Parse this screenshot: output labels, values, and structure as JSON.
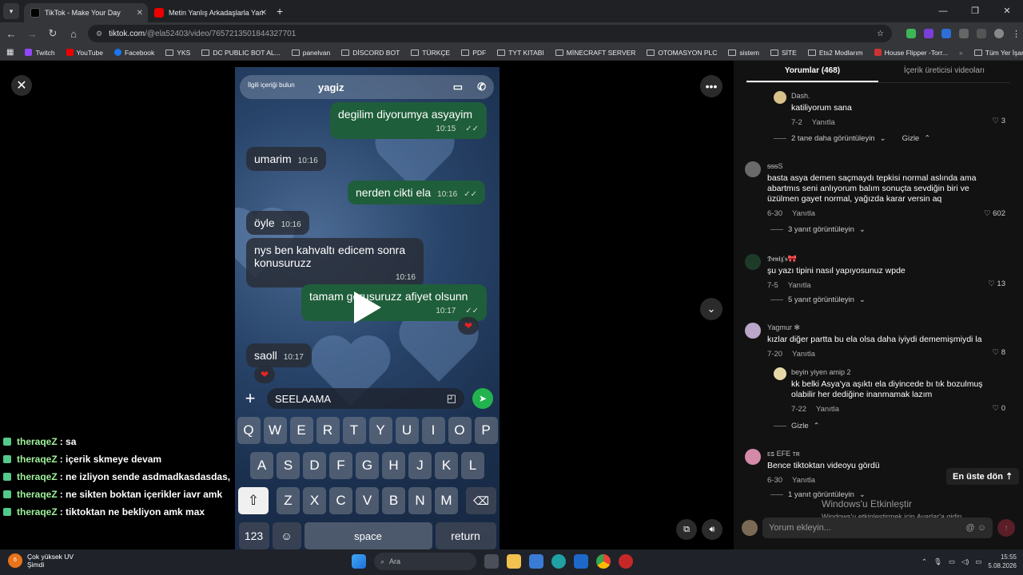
{
  "browser": {
    "tabs": [
      {
        "title": "TikTok - Make Your Day",
        "active": true
      },
      {
        "title": "Metin Yanlış Arkadaşlarla Yanlış",
        "active": false
      }
    ],
    "url_host": "tiktok.com",
    "url_path": "/@ela52403/video/7657213501844327701",
    "bookmarks": [
      "Twitch",
      "YouTube",
      "Facebook",
      "YKS",
      "DC PUBLIC BOT AL...",
      "panelvan",
      "DİSCORD BOT",
      "TÜRKÇE",
      "PDF",
      "TYT KITABI",
      "MİNECRAFT SERVER",
      "OTOMASYON PLC",
      "sistem",
      "SİTE",
      "Ets2 Modlarım",
      "House Flipper -Torr..."
    ],
    "all_bookmarks": "Tüm Yer İşaretleri"
  },
  "video": {
    "header_hint": "İlgili içeriği bulun",
    "contact_name": "yagiz",
    "messages": [
      {
        "dir": "out",
        "text": "degilim diyorumya asyayim",
        "time": "10:15"
      },
      {
        "dir": "in",
        "text": "umarim",
        "time": "10:16"
      },
      {
        "dir": "out",
        "text": "nerden cikti ela",
        "time": "10:16"
      },
      {
        "dir": "in",
        "text": "öyle",
        "time": "10:16"
      },
      {
        "dir": "in",
        "text": "nys ben kahvaltı edicem sonra konusuruzz",
        "time": "10:16"
      },
      {
        "dir": "out",
        "text": "tamam gorusuruzz afiyet olsunn",
        "time": "10:17"
      },
      {
        "dir": "in",
        "text": "saoll",
        "time": "10:17"
      }
    ],
    "composer_text": "SEELAAMA",
    "keyboard": {
      "row1": [
        "Q",
        "W",
        "E",
        "R",
        "T",
        "Y",
        "U",
        "I",
        "O",
        "P"
      ],
      "row2": [
        "A",
        "S",
        "D",
        "F",
        "G",
        "H",
        "J",
        "K",
        "L"
      ],
      "row3": [
        "Z",
        "X",
        "C",
        "V",
        "B",
        "N",
        "M"
      ],
      "num": "123",
      "space": "space",
      "return": "return"
    }
  },
  "live_chat": [
    {
      "user": "theraqeZ",
      "text": ": sa"
    },
    {
      "user": "theraqeZ",
      "text": ": içerik skmeye devam"
    },
    {
      "user": "theraqeZ",
      "text": ": ne izliyon sende asdmadkasdasdas,"
    },
    {
      "user": "theraqeZ",
      "text": ": ne sikten boktan içerikler iavr amk"
    },
    {
      "user": "theraqeZ",
      "text": ": tiktoktan ne bekliyon amk max"
    }
  ],
  "comments_panel": {
    "tab_comments": "Yorumlar (468)",
    "tab_creator": "İçerik üreticisi videoları",
    "comments": [
      {
        "user": "Dash.",
        "text": "katiliyorum sana",
        "date": "7-2",
        "reply": "Yanıtla",
        "likes": "3"
      },
      {
        "user": "ᵴᵴᵴS",
        "text": "basta asya demen saçmaydı tepkisi normal aslında ama abartmıs seni anlıyorum balım sonuçta sevdiğin biri ve üzülmen gayet normal, yağızda karar versin aq",
        "date": "6-30",
        "reply": "Yanıtla",
        "likes": "602"
      },
      {
        "user": "𝕯𝖊𝖓𝖎𝖟'𝖘🎀",
        "text": "şu yazı tipini nasıl yapıyosunuz wpde",
        "date": "7-5",
        "reply": "Yanıtla",
        "likes": "13"
      },
      {
        "user": "Yagmur ✻",
        "text": "kızlar diğer partta bu ela olsa daha iyiydi dememişmiydi la",
        "date": "7-20",
        "reply": "Yanıtla",
        "likes": "8"
      },
      {
        "user": "beyin yiyen amip 2",
        "text": "kk belki Asya'ya aşıktı ela diyincede bı tık bozulmuş olabilir her dediğine inanmamak lazım",
        "date": "7-22",
        "reply": "Yanıtla",
        "likes": "0"
      },
      {
        "user": "ᴇꜱ EFE ᴛʀ",
        "text": "Bence tiktoktan videoyu gördü",
        "date": "6-30",
        "reply": "Yanıtla",
        "likes": ""
      }
    ],
    "more_replies": [
      "2 tane daha görüntüleyin",
      "3 yanıt görüntüleyin",
      "5 yanıt görüntüleyin",
      "1 yanıt görüntüleyin"
    ],
    "hide": "Gizle",
    "back_to_top": "En üste dön",
    "comment_placeholder": "Yorum ekleyin...",
    "windows_activate": "Windows'u Etkinleştir",
    "windows_activate_sub": "Windows'u etkinleştirmek için Ayarlar'a gidin."
  },
  "taskbar": {
    "weather_title": "Çok yüksek UV",
    "weather_sub": "Şimdi",
    "weather_badge": "6",
    "search": "Ara",
    "time": "15:55",
    "date": "5.08.2026"
  }
}
